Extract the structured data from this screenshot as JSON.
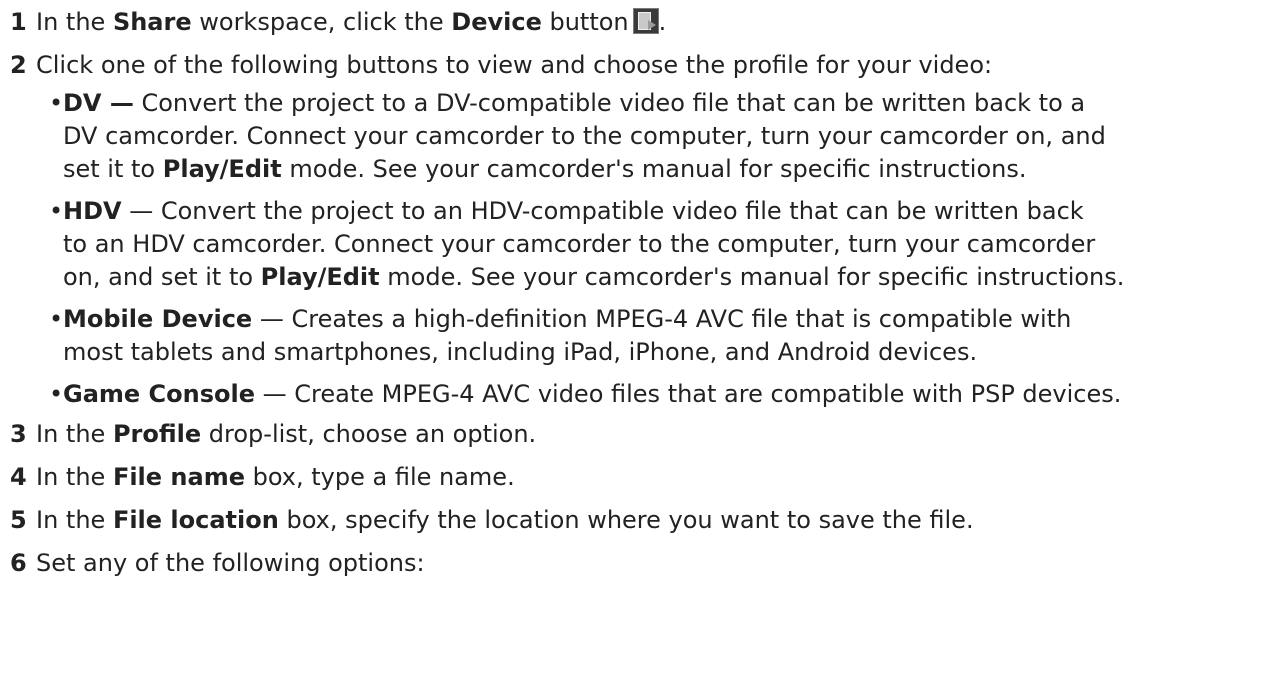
{
  "steps": [
    {
      "num": "1",
      "pre": "In the ",
      "b1": "Share",
      "mid": " workspace, click the ",
      "b2": "Device",
      "post": " button",
      "icon": "device-icon",
      "end": "."
    },
    {
      "num": "2",
      "text": "Click one of the following buttons to view and choose the profile for your video:",
      "bullets": [
        {
          "dot": "•",
          "title": "DV —",
          "lines": [
            " Convert the project to a DV-compatible video file that can be written back to a",
            "DV camcorder. Connect your camcorder to the computer, turn your camcorder on, and"
          ],
          "last_pre": "set it to ",
          "last_bold": "Play/Edit",
          "last_post": " mode. See your camcorder's manual for specific instructions."
        },
        {
          "dot": "•",
          "title": "HDV",
          "lines": [
            " — Convert the project to an HDV-compatible video file that can be written back",
            "to an HDV camcorder. Connect your camcorder to the computer, turn your camcorder"
          ],
          "last_pre": "on, and set it to ",
          "last_bold": "Play/Edit",
          "last_post": " mode. See your camcorder's manual for specific instructions."
        },
        {
          "dot": "•",
          "title": "Mobile Device",
          "line1": " — Creates a high-definition MPEG-4 AVC file that is compatible with",
          "line2": "most tablets and smartphones, including iPad, iPhone, and Android devices."
        },
        {
          "dot": "•",
          "title": "Game Console",
          "line1": " — Create MPEG-4 AVC video files that are compatible with PSP devices."
        }
      ]
    },
    {
      "num": "3",
      "pre": "In the ",
      "bold": "Profile",
      "post": " drop-list, choose an option."
    },
    {
      "num": "4",
      "pre": "In the ",
      "bold": "File name",
      "post": " box, type a file name."
    },
    {
      "num": "5",
      "pre": "In the ",
      "bold": "File location",
      "post": " box, specify the location where you want to save the file."
    },
    {
      "num": "6",
      "text": "Set any of the following options:"
    }
  ]
}
